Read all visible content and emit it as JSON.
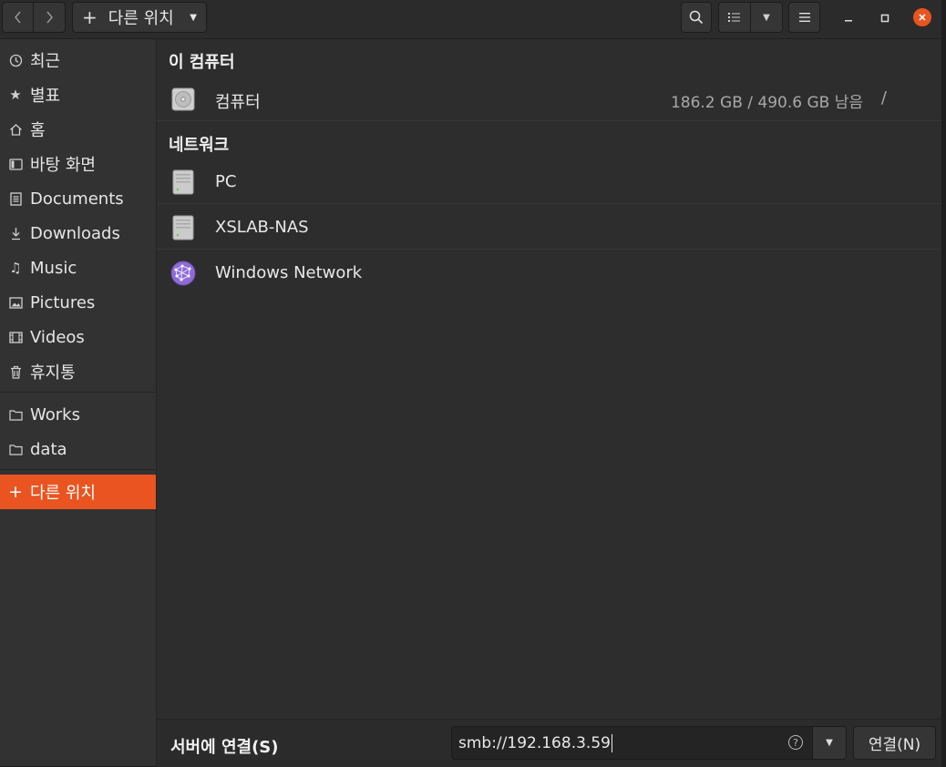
{
  "header": {
    "back_icon": "chevron-left-icon",
    "forward_icon": "chevron-right-icon",
    "path_label": "다른 위치",
    "search_icon": "search-icon",
    "view_icon": "list-view-icon",
    "menu_icon": "hamburger-icon"
  },
  "sidebar": {
    "items": [
      {
        "label": "최근",
        "icon": "clock-icon"
      },
      {
        "label": "별표",
        "icon": "star-icon"
      },
      {
        "label": "홈",
        "icon": "home-icon"
      },
      {
        "label": "바탕 화면",
        "icon": "desktop-icon"
      },
      {
        "label": "Documents",
        "icon": "document-icon"
      },
      {
        "label": "Downloads",
        "icon": "download-icon"
      },
      {
        "label": "Music",
        "icon": "music-icon"
      },
      {
        "label": "Pictures",
        "icon": "picture-icon"
      },
      {
        "label": "Videos",
        "icon": "video-icon"
      },
      {
        "label": "휴지통",
        "icon": "trash-icon"
      }
    ],
    "bookmarks": [
      {
        "label": "Works",
        "icon": "folder-icon"
      },
      {
        "label": "data",
        "icon": "folder-icon"
      }
    ],
    "other_locations": {
      "label": "다른 위치",
      "icon": "plus-icon"
    }
  },
  "main": {
    "this_computer": {
      "title": "이 컴퓨터",
      "items": [
        {
          "name": "컴퓨터",
          "info": "186.2 GB / 490.6 GB 남음",
          "mount": "/"
        }
      ]
    },
    "network": {
      "title": "네트워크",
      "items": [
        {
          "name": "PC"
        },
        {
          "name": "XSLAB-NAS"
        },
        {
          "name": "Windows Network"
        }
      ]
    }
  },
  "bottom": {
    "connect_label": "서버에 연결(S)",
    "server_address": "smb://192.168.3.59",
    "connect_button": "연결(N)"
  },
  "colors": {
    "accent": "#e95420",
    "background": "#2d2d2d",
    "sidebar": "#323232"
  }
}
